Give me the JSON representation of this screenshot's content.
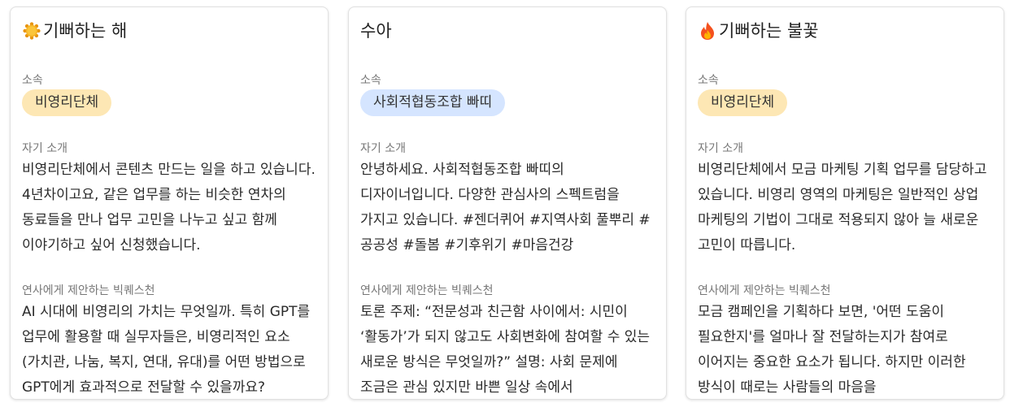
{
  "colors": {
    "badge_nonprofit": "#fde7b4",
    "badge_coop": "#d5e5ff",
    "card_border": "#e1e1e1",
    "label_gray": "#777777"
  },
  "cards": [
    {
      "icon": "sun-icon",
      "name": "기뻐하는 해",
      "affiliation_label": "소속",
      "affiliation": "비영리단체",
      "affiliation_color": "#fde7b4",
      "intro_label": "자기 소개",
      "intro": "비영리단체에서 콘텐츠 만드는 일을 하고 있습니다. 4년차이고요, 같은 업무를 하는 비슷한 연차의 동료들을 만나 업무 고민을 나누고 싶고 함께 이야기하고 싶어 신청했습니다.",
      "question_label": "연사에게 제안하는 빅퀘스천",
      "question": "AI 시대에 비영리의 가치는 무엇일까. 특히 GPT를 업무에 활용할 때 실무자들은, 비영리적인 요소 (가치관, 나눔, 복지, 연대, 유대)를 어떤 방법으로 GPT에게 효과적으로 전달할 수 있을까요?"
    },
    {
      "icon": "",
      "name": "수아",
      "affiliation_label": "소속",
      "affiliation": "사회적협동조합 빠띠",
      "affiliation_color": "#d5e5ff",
      "intro_label": "자기 소개",
      "intro": "안녕하세요. 사회적협동조합 빠띠의 디자이너입니다. 다양한 관심사의 스펙트럼을 가지고 있습니다. #젠더퀴어 #지역사회 풀뿌리 #공공성 #돌봄 #기후위기 #마음건강",
      "question_label": "연사에게 제안하는 빅퀘스천",
      "question": "토론 주제: “전문성과 친근함 사이에서: 시민이 ‘활동가’가 되지 않고도 사회변화에 참여할 수 있는 새로운 방식은 무엇일까?” 설명: 사회 문제에 조금은 관심 있지만 바쁜 일상 속에서"
    },
    {
      "icon": "fire-icon",
      "name": "기뻐하는 불꽃",
      "affiliation_label": "소속",
      "affiliation": "비영리단체",
      "affiliation_color": "#fde7b4",
      "intro_label": "자기 소개",
      "intro": "비영리단체에서 모금 마케팅 기획 업무를 담당하고 있습니다. 비영리 영역의 마케팅은 일반적인 상업 마케팅의 기법이 그대로 적용되지 않아 늘 새로운 고민이 따릅니다.",
      "question_label": "연사에게 제안하는 빅퀘스천",
      "question": "모금 캠페인을 기획하다 보면, '어떤 도움이 필요한지'를 얼마나 잘 전달하는지가 참여로 이어지는 중요한 요소가 됩니다. 하지만 이러한 방식이 때로는 사람들의 마음을"
    }
  ]
}
